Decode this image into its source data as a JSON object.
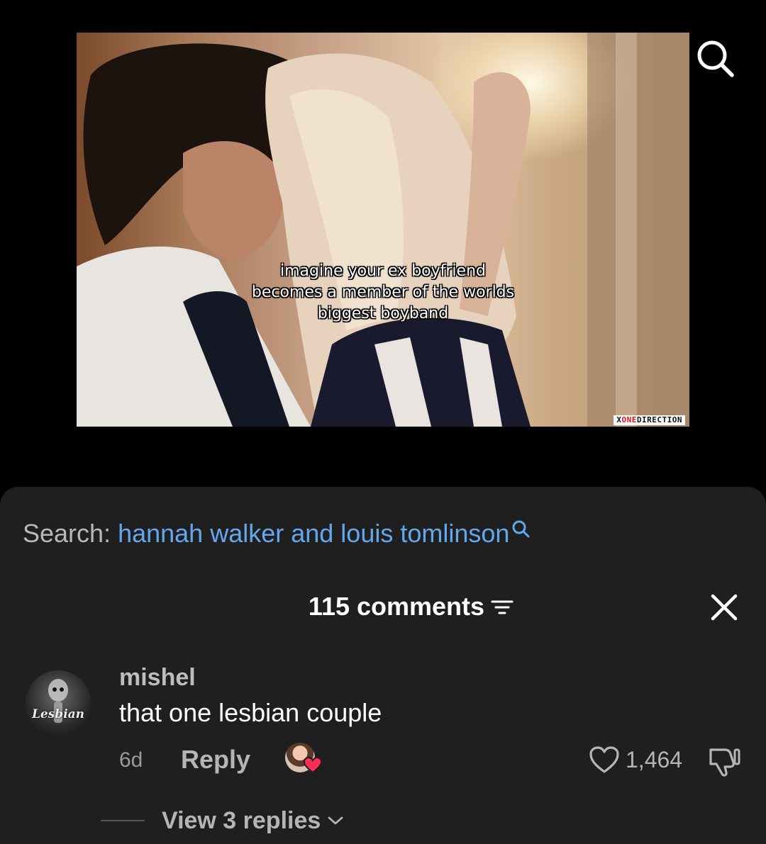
{
  "video": {
    "caption": "imagine your ex boyfriend\nbecomes a member of the worlds\nbiggest boyband",
    "watermark_prefix": "X",
    "watermark_red": "ONE",
    "watermark_suffix": "DIRECTION"
  },
  "search": {
    "label": "Search: ",
    "query": "hannah walker and louis tomlinson"
  },
  "comments_header": {
    "title": "115 comments"
  },
  "comment": {
    "avatar_text": "Lesbian",
    "username": "mishel",
    "text": "that one lesbian couple",
    "time": "6d",
    "reply_label": "Reply",
    "like_count": "1,464",
    "view_replies": "View 3 replies"
  },
  "icons": {
    "top_right": "search-icon",
    "filter": "filter-icon",
    "close": "close-icon",
    "like": "heart-outline-icon",
    "dislike": "thumbs-down-icon",
    "expand": "chevron-down-icon",
    "creator_like": "creator-liked-heart-icon"
  },
  "colors": {
    "sheet_bg": "#1f1f1f",
    "search_query": "#63a8ec",
    "creator_heart": "#fe2c55"
  }
}
